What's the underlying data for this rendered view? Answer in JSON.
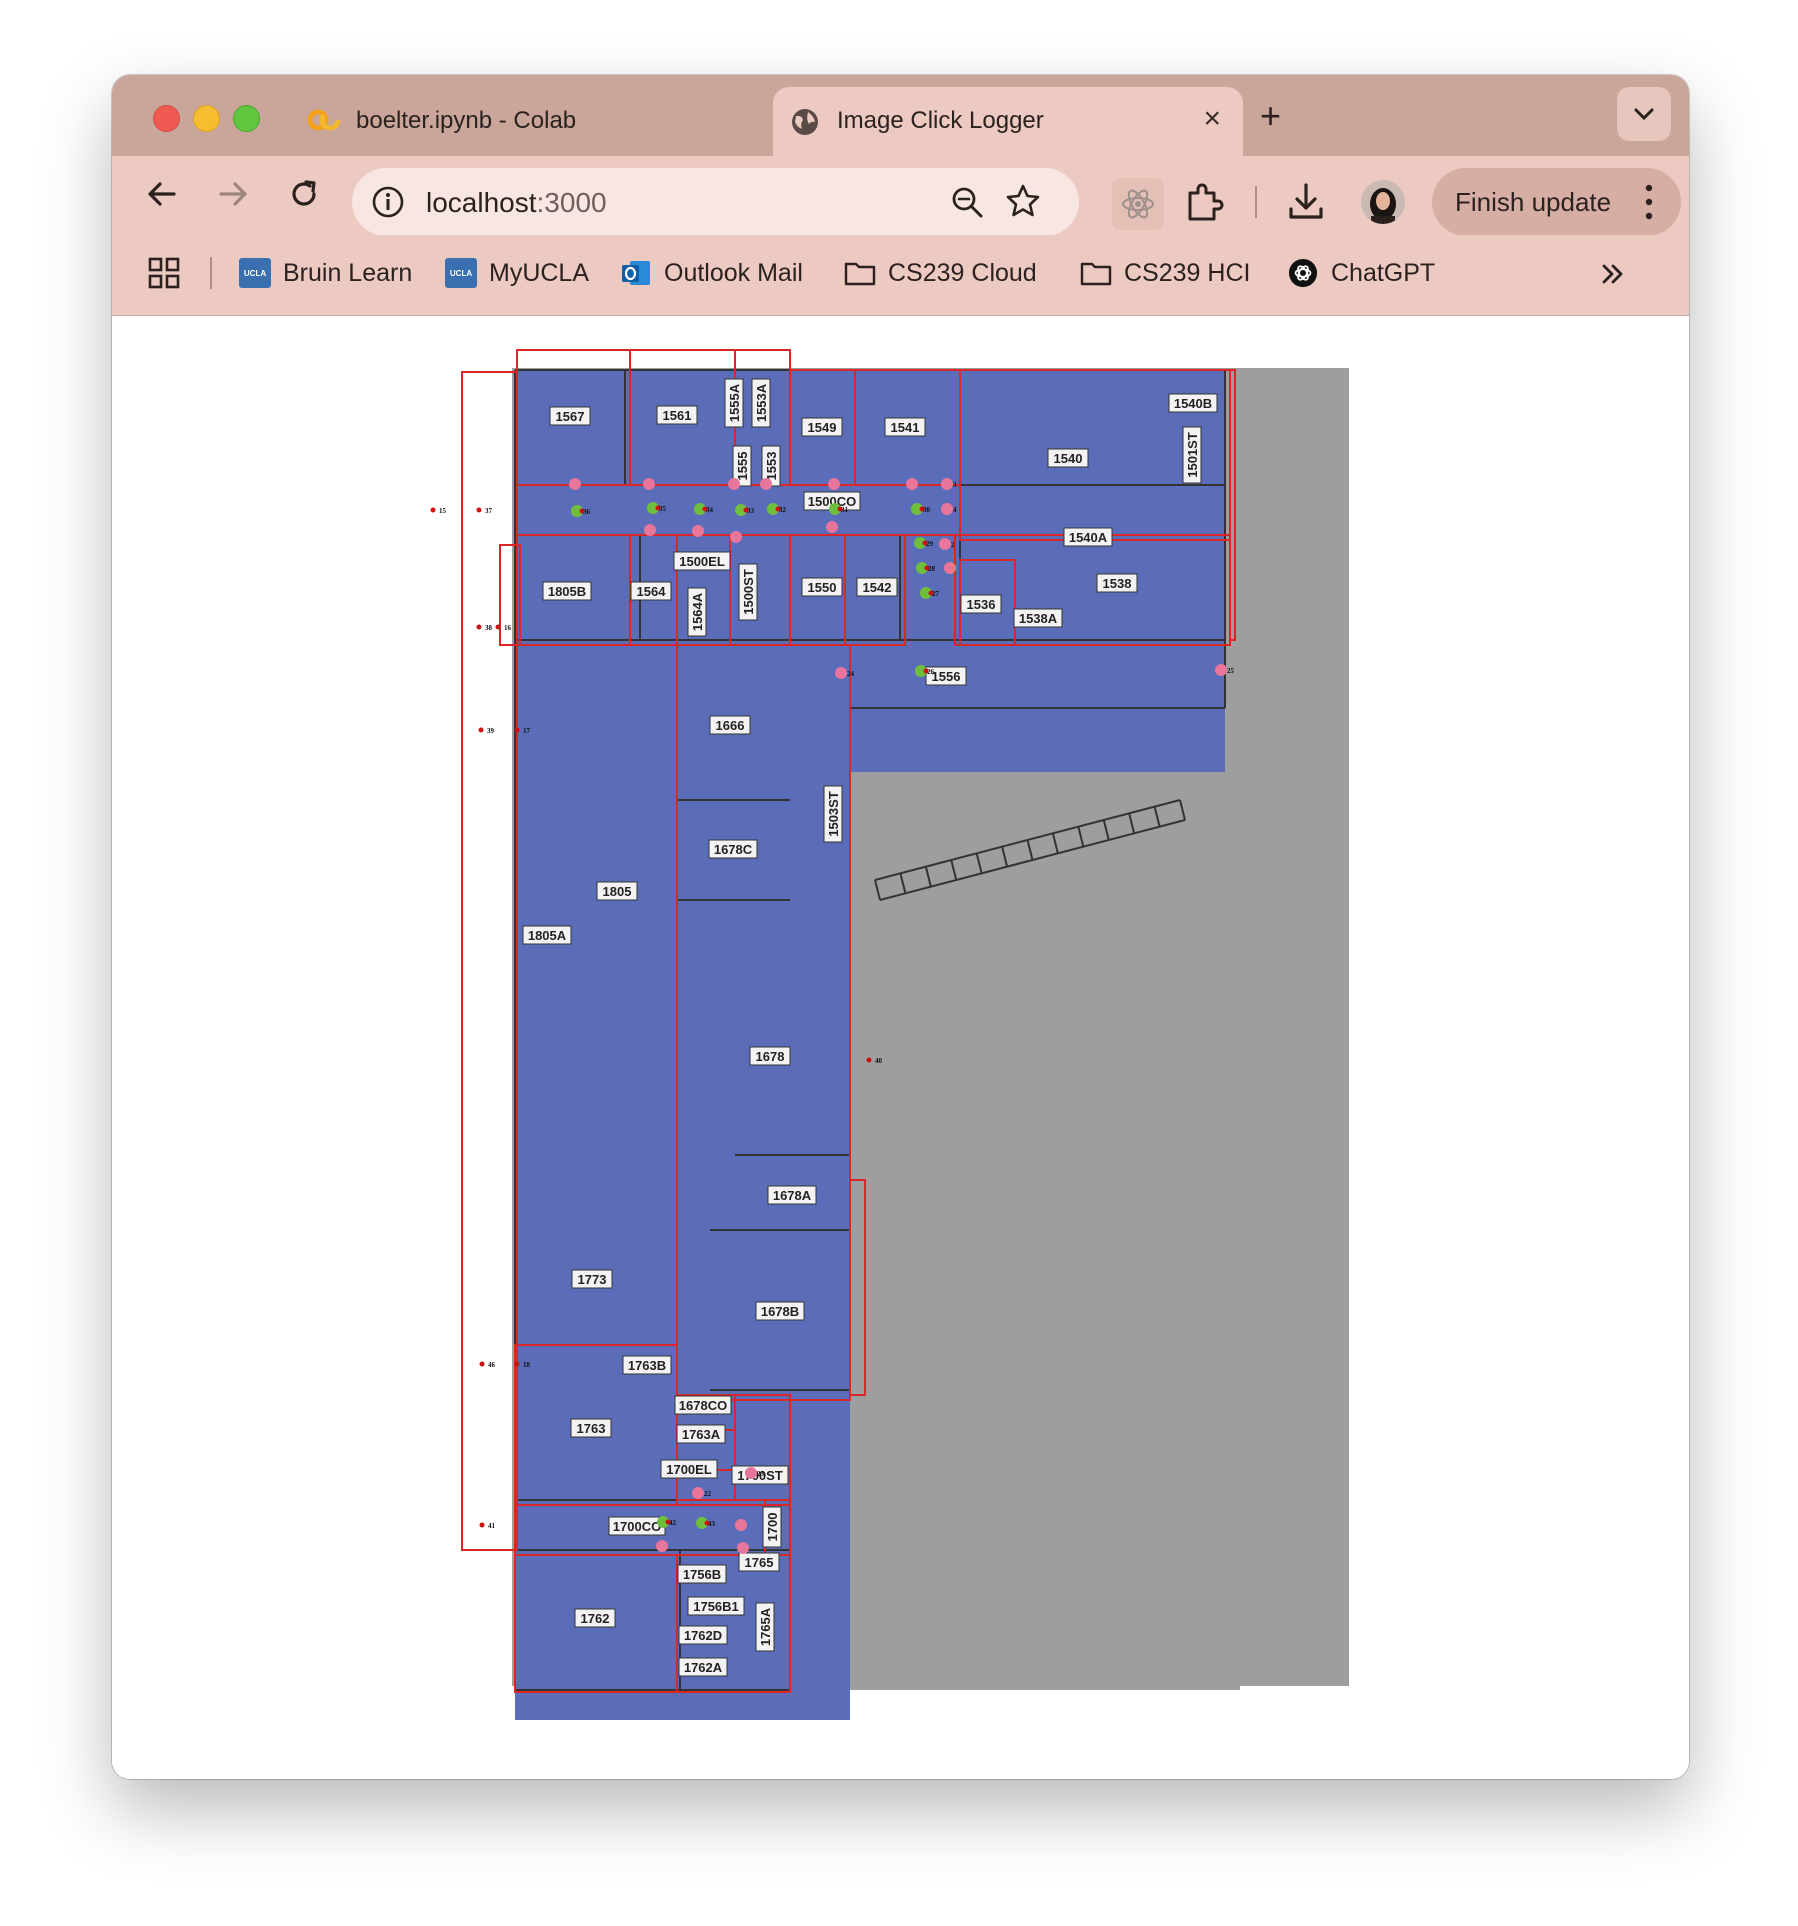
{
  "browser": {
    "tabs": [
      {
        "title": "boelter.ipynb - Colab",
        "icon": "colab-icon",
        "active": false
      },
      {
        "title": "Image Click Logger",
        "icon": "globe-icon",
        "active": true
      }
    ],
    "url_host": "localhost",
    "url_port": ":3000",
    "finish_update_label": "Finish update",
    "bookmarks": [
      {
        "label": "Bruin Learn",
        "icon": "ucla-icon"
      },
      {
        "label": "MyUCLA",
        "icon": "ucla-icon"
      },
      {
        "label": "Outlook Mail",
        "icon": "outlook-icon"
      },
      {
        "label": "CS239 Cloud",
        "icon": "folder-icon"
      },
      {
        "label": "CS239 HCI",
        "icon": "folder-icon"
      },
      {
        "label": "ChatGPT",
        "icon": "chatgpt-icon"
      }
    ],
    "ucla_badge_text": "UCLA"
  },
  "floorplan": {
    "colors": {
      "room": "#5b6db8",
      "background_gray": "#9d9e9e",
      "box_outline": "#d92626",
      "pink_dot": "#e8759a",
      "green_dot": "#6fbf3f",
      "red_dot": "#cc1111"
    },
    "rooms": [
      "1567",
      "1561",
      "1555A",
      "1553A",
      "1549",
      "1541",
      "1540",
      "1540B",
      "1501ST",
      "1555",
      "1553",
      "1500CO",
      "1540A",
      "1805B",
      "1564",
      "1500EL",
      "1564A",
      "1500ST",
      "1550",
      "1542",
      "1536",
      "1538A",
      "1538",
      "1556",
      "1666",
      "1503ST",
      "1678C",
      "1805",
      "1805A",
      "1678",
      "1678A",
      "1773",
      "1678B",
      "1763B",
      "1678CO",
      "1763",
      "1763A",
      "1700EL",
      "1700ST",
      "1700CO",
      "1700",
      "1765",
      "1756B",
      "1756B1",
      "1762",
      "1762D",
      "1765A",
      "1762A"
    ],
    "point_labels": [
      "15",
      "37",
      "38",
      "16",
      "39",
      "17",
      "46",
      "18",
      "41",
      "40",
      "36",
      "35",
      "34",
      "33",
      "32",
      "31",
      "30",
      "29",
      "28",
      "27",
      "26",
      "24",
      "25",
      "3",
      "4",
      "2",
      "42",
      "43",
      "22",
      "23"
    ]
  }
}
